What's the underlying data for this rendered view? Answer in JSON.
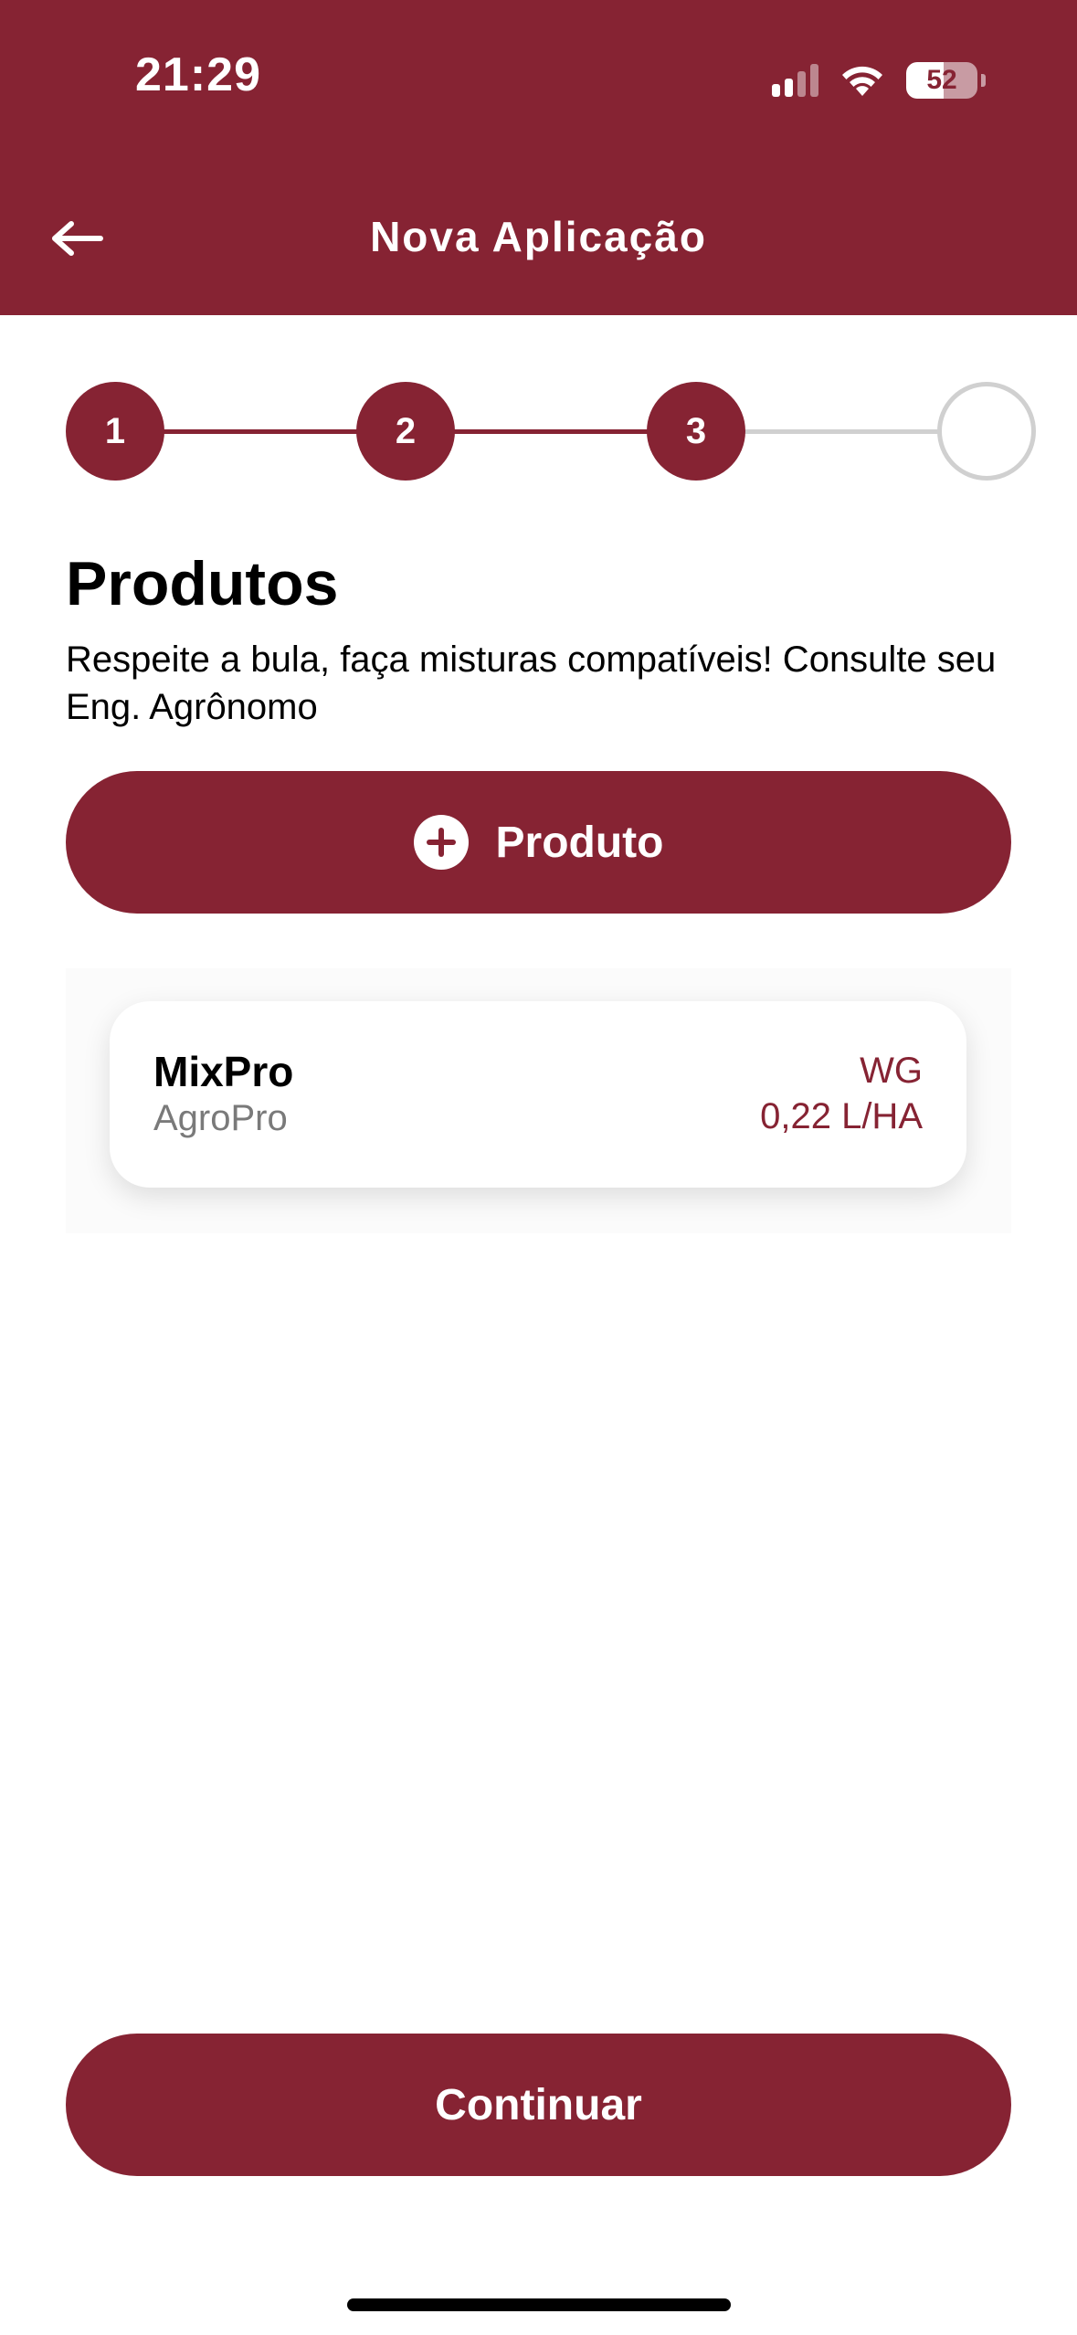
{
  "status_bar": {
    "time": "21:29",
    "battery_percent": "52",
    "battery_level": 0.52,
    "signal_bars_active": 2,
    "signal_bars_total": 4
  },
  "header": {
    "title": "Nova Aplicação",
    "back_icon": "arrow-left-icon"
  },
  "stepper": {
    "current_step": 3,
    "steps": [
      {
        "label": "1",
        "state": "done"
      },
      {
        "label": "2",
        "state": "done"
      },
      {
        "label": "3",
        "state": "done"
      },
      {
        "label": "",
        "state": "todo"
      }
    ]
  },
  "section": {
    "title": "Produtos",
    "subtitle": "Respeite a bula, faça misturas compatíveis! Consulte seu Eng. Agrônomo"
  },
  "add_product": {
    "label": "Produto",
    "icon": "plus-circle-icon"
  },
  "products": [
    {
      "name": "MixPro",
      "brand": "AgroPro",
      "formulation": "WG",
      "dose": "0,22 L/HA"
    }
  ],
  "footer": {
    "continue_label": "Continuar"
  },
  "colors": {
    "primary": "#862333",
    "inactive": "#d0d0d0",
    "muted_text": "#7a7a7a"
  }
}
